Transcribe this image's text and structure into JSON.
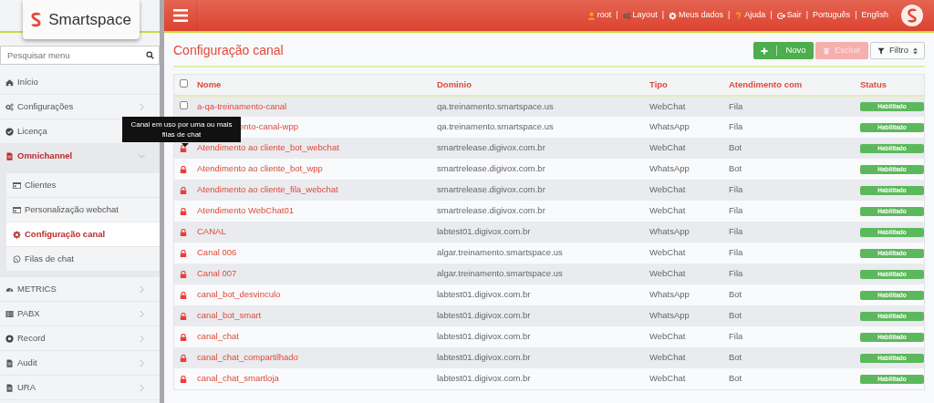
{
  "brand": {
    "name": "Smartspace"
  },
  "search": {
    "placeholder": "Pesquisar menu"
  },
  "sidebar": {
    "items": [
      {
        "label": "Início"
      },
      {
        "label": "Configurações",
        "expanded": false
      },
      {
        "label": "Licença",
        "expanded": false
      },
      {
        "label": "Omnichannel",
        "expanded": true,
        "children": [
          {
            "label": "Clientes",
            "selected": false
          },
          {
            "label": "Personalização webchat",
            "selected": false
          },
          {
            "label": "Configuração canal",
            "selected": true
          },
          {
            "label": "Filas de chat",
            "selected": false
          }
        ]
      },
      {
        "label": "METRICS",
        "expanded": false
      },
      {
        "label": "PABX",
        "expanded": false
      },
      {
        "label": "Record",
        "expanded": false
      },
      {
        "label": "Audit",
        "expanded": false
      },
      {
        "label": "URA",
        "expanded": false
      }
    ]
  },
  "header": {
    "separator": "|",
    "links": [
      {
        "label": "root"
      },
      {
        "label": "Layout"
      },
      {
        "label": "Meus dados"
      },
      {
        "label": "Ajuda"
      },
      {
        "label": "Sair"
      },
      {
        "label": "Português"
      }
    ],
    "last_link": "English"
  },
  "page": {
    "title": "Configuração canal"
  },
  "toolbar": [
    {
      "label": "Novo",
      "kind": "new",
      "disabled": false
    },
    {
      "label": "Excluir",
      "kind": "delete",
      "disabled": true
    },
    {
      "label": "Filtro",
      "kind": "filter",
      "disabled": false
    }
  ],
  "table": {
    "select_all_checked": false,
    "columns": [
      "Nome",
      "Dominio",
      "Tipo",
      "Atendimento com",
      "Status"
    ],
    "rows": [
      {
        "kind": "checkbox",
        "checked": false,
        "name": "a-qa-treinamento-canal",
        "domain": "qa.treinamento.smartspace.us",
        "type": "WebChat",
        "handled_by": "Fila",
        "status": "Habilitado"
      },
      {
        "kind": "covered",
        "name": "ento-canal-wpp",
        "domain": "qa.treinamento.smartspace.us",
        "type": "WhatsApp",
        "handled_by": "Fila",
        "status": "Habilitado"
      },
      {
        "kind": "lock",
        "name": "Atendimento ao cliente_bot_webchat",
        "domain": "smartrelease.digivox.com.br",
        "type": "WebChat",
        "handled_by": "Bot",
        "status": "Habilitado"
      },
      {
        "kind": "lock",
        "name": "Atendimento ao cliente_bot_wpp",
        "domain": "smartrelease.digivox.com.br",
        "type": "WhatsApp",
        "handled_by": "Bot",
        "status": "Habilitado"
      },
      {
        "kind": "lock",
        "name": "Atendimento ao cliente_fila_webchat",
        "domain": "smartrelease.digivox.com.br",
        "type": "WebChat",
        "handled_by": "Fila",
        "status": "Habilitado"
      },
      {
        "kind": "lock",
        "name": "Atendimento WebChat01",
        "domain": "smartrelease.digivox.com.br",
        "type": "WebChat",
        "handled_by": "Fila",
        "status": "Habilitado"
      },
      {
        "kind": "lock",
        "name": "CANAL",
        "domain": "labtest01.digivox.com.br",
        "type": "WhatsApp",
        "handled_by": "Fila",
        "status": "Habilitado"
      },
      {
        "kind": "lock",
        "name": "Canal 006",
        "domain": "algar.treinamento.smartspace.us",
        "type": "WebChat",
        "handled_by": "Fila",
        "status": "Habilitado"
      },
      {
        "kind": "lock",
        "name": "Canal 007",
        "domain": "algar.treinamento.smartspace.us",
        "type": "WebChat",
        "handled_by": "Fila",
        "status": "Habilitado"
      },
      {
        "kind": "lock",
        "name": "canal_bot_desvinculo",
        "domain": "labtest01.digivox.com.br",
        "type": "WhatsApp",
        "handled_by": "Bot",
        "status": "Habilitado"
      },
      {
        "kind": "lock",
        "name": "canal_bot_smart",
        "domain": "labtest01.digivox.com.br",
        "type": "WhatsApp",
        "handled_by": "Bot",
        "status": "Habilitado"
      },
      {
        "kind": "lock",
        "name": "canal_chat",
        "domain": "labtest01.digivox.com.br",
        "type": "WebChat",
        "handled_by": "Fila",
        "status": "Habilitado"
      },
      {
        "kind": "lock",
        "name": "canal_chat_compartilhado",
        "domain": "labtest01.digivox.com.br",
        "type": "WebChat",
        "handled_by": "Bot",
        "status": "Habilitado"
      },
      {
        "kind": "lock",
        "name": "canal_chat_smartloja",
        "domain": "labtest01.digivox.com.br",
        "type": "WebChat",
        "handled_by": "Bot",
        "status": "Habilitado"
      }
    ]
  },
  "tooltip": {
    "text": "Canal em uso por uma ou mais filas de chat"
  }
}
